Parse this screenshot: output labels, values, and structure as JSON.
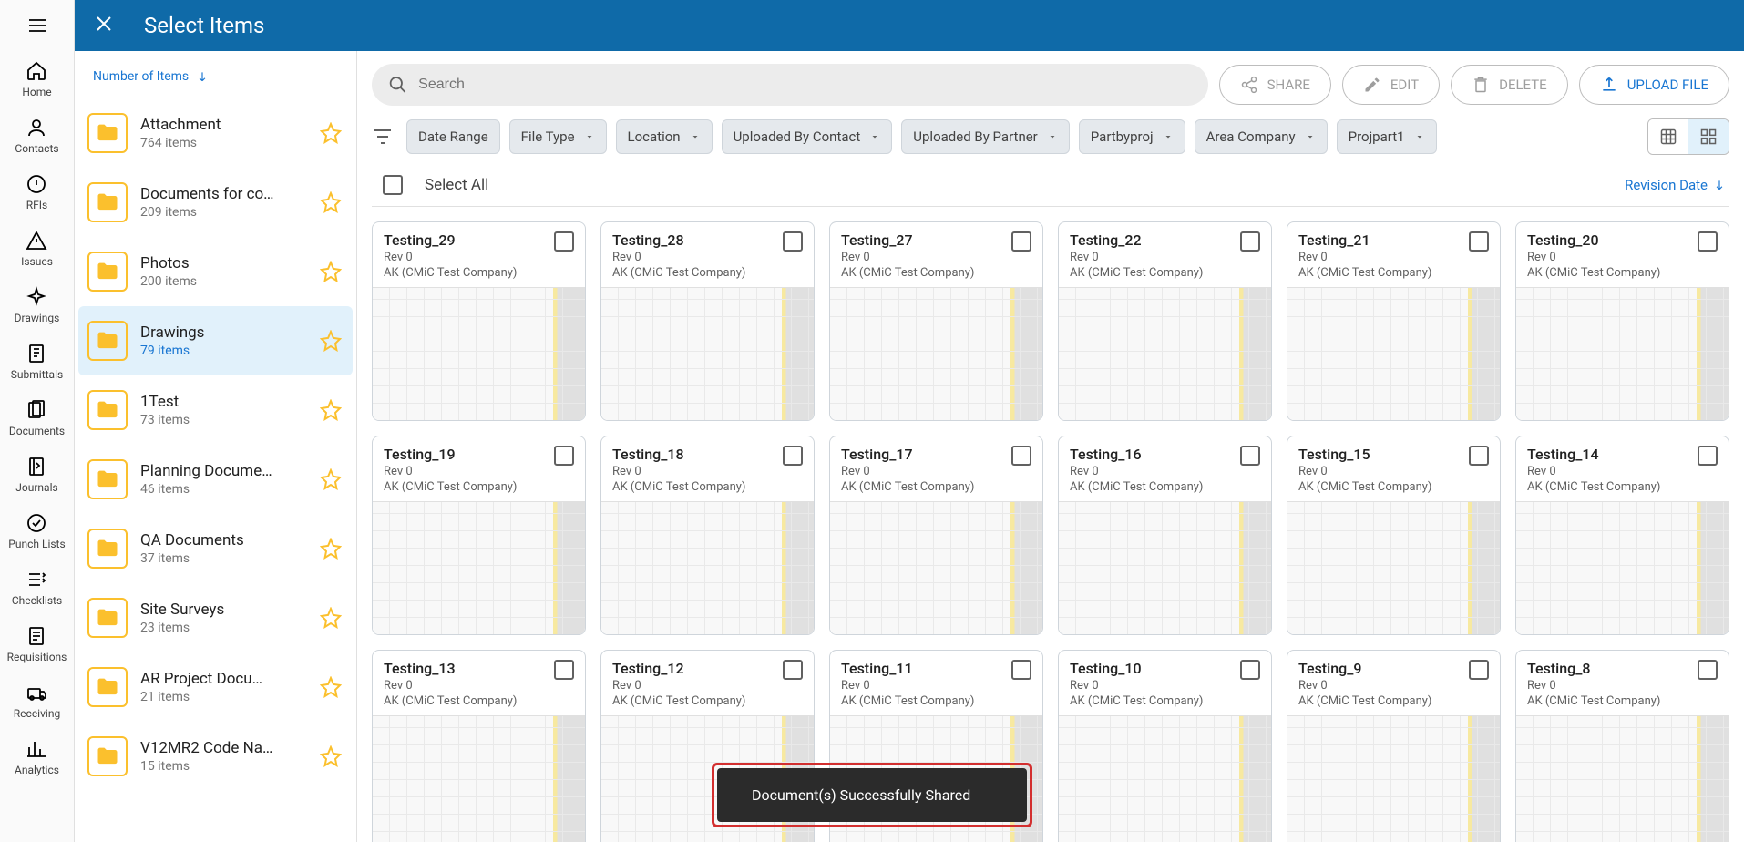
{
  "header": {
    "title": "Select Items"
  },
  "rail": [
    {
      "label": "Home"
    },
    {
      "label": "Contacts"
    },
    {
      "label": "RFIs"
    },
    {
      "label": "Issues"
    },
    {
      "label": "Drawings"
    },
    {
      "label": "Submittals"
    },
    {
      "label": "Documents"
    },
    {
      "label": "Journals"
    },
    {
      "label": "Punch Lists"
    },
    {
      "label": "Checklists"
    },
    {
      "label": "Requisitions"
    },
    {
      "label": "Receiving"
    },
    {
      "label": "Analytics"
    }
  ],
  "folder_sort_label": "Number of Items",
  "folders": [
    {
      "name": "Attachment",
      "count": "764 items",
      "active": false
    },
    {
      "name": "Documents for co…",
      "count": "209 items",
      "active": false
    },
    {
      "name": "Photos",
      "count": "200 items",
      "active": false
    },
    {
      "name": "Drawings",
      "count": "79 items",
      "active": true
    },
    {
      "name": "1Test",
      "count": "73 items",
      "active": false
    },
    {
      "name": "Planning Docume…",
      "count": "46 items",
      "active": false
    },
    {
      "name": "QA Documents",
      "count": "37 items",
      "active": false
    },
    {
      "name": "Site Surveys",
      "count": "23 items",
      "active": false
    },
    {
      "name": "AR Project Docu…",
      "count": "21 items",
      "active": false
    },
    {
      "name": "V12MR2 Code Na…",
      "count": "15 items",
      "active": false
    }
  ],
  "toolbar": {
    "search_placeholder": "Search",
    "share": "SHARE",
    "edit": "EDIT",
    "delete": "DELETE",
    "upload": "UPLOAD FILE"
  },
  "filters": [
    {
      "label": "Date Range",
      "dropdown": false
    },
    {
      "label": "File Type",
      "dropdown": true
    },
    {
      "label": "Location",
      "dropdown": true
    },
    {
      "label": "Uploaded By Contact",
      "dropdown": true
    },
    {
      "label": "Uploaded By Partner",
      "dropdown": true
    },
    {
      "label": "Partbyproj",
      "dropdown": true
    },
    {
      "label": "Area Company",
      "dropdown": true
    },
    {
      "label": "Projpart1",
      "dropdown": true
    }
  ],
  "select_all_label": "Select All",
  "grid_sort_label": "Revision Date",
  "cards": [
    {
      "title": "Testing_29",
      "rev": "Rev 0",
      "owner": "AK (CMiC Test Company)"
    },
    {
      "title": "Testing_28",
      "rev": "Rev 0",
      "owner": "AK (CMiC Test Company)"
    },
    {
      "title": "Testing_27",
      "rev": "Rev 0",
      "owner": "AK (CMiC Test Company)"
    },
    {
      "title": "Testing_22",
      "rev": "Rev 0",
      "owner": "AK (CMiC Test Company)"
    },
    {
      "title": "Testing_21",
      "rev": "Rev 0",
      "owner": "AK (CMiC Test Company)"
    },
    {
      "title": "Testing_20",
      "rev": "Rev 0",
      "owner": "AK (CMiC Test Company)"
    },
    {
      "title": "Testing_19",
      "rev": "Rev 0",
      "owner": "AK (CMiC Test Company)"
    },
    {
      "title": "Testing_18",
      "rev": "Rev 0",
      "owner": "AK (CMiC Test Company)"
    },
    {
      "title": "Testing_17",
      "rev": "Rev 0",
      "owner": "AK (CMiC Test Company)"
    },
    {
      "title": "Testing_16",
      "rev": "Rev 0",
      "owner": "AK (CMiC Test Company)"
    },
    {
      "title": "Testing_15",
      "rev": "Rev 0",
      "owner": "AK (CMiC Test Company)"
    },
    {
      "title": "Testing_14",
      "rev": "Rev 0",
      "owner": "AK (CMiC Test Company)"
    },
    {
      "title": "Testing_13",
      "rev": "Rev 0",
      "owner": "AK (CMiC Test Company)"
    },
    {
      "title": "Testing_12",
      "rev": "Rev 0",
      "owner": "AK (CMiC Test Company)"
    },
    {
      "title": "Testing_11",
      "rev": "Rev 0",
      "owner": "AK (CMiC Test Company)"
    },
    {
      "title": "Testing_10",
      "rev": "Rev 0",
      "owner": "AK (CMiC Test Company)"
    },
    {
      "title": "Testing_9",
      "rev": "Rev 0",
      "owner": "AK (CMiC Test Company)"
    },
    {
      "title": "Testing_8",
      "rev": "Rev 0",
      "owner": "AK (CMiC Test Company)"
    }
  ],
  "toast": "Document(s) Successfully Shared"
}
